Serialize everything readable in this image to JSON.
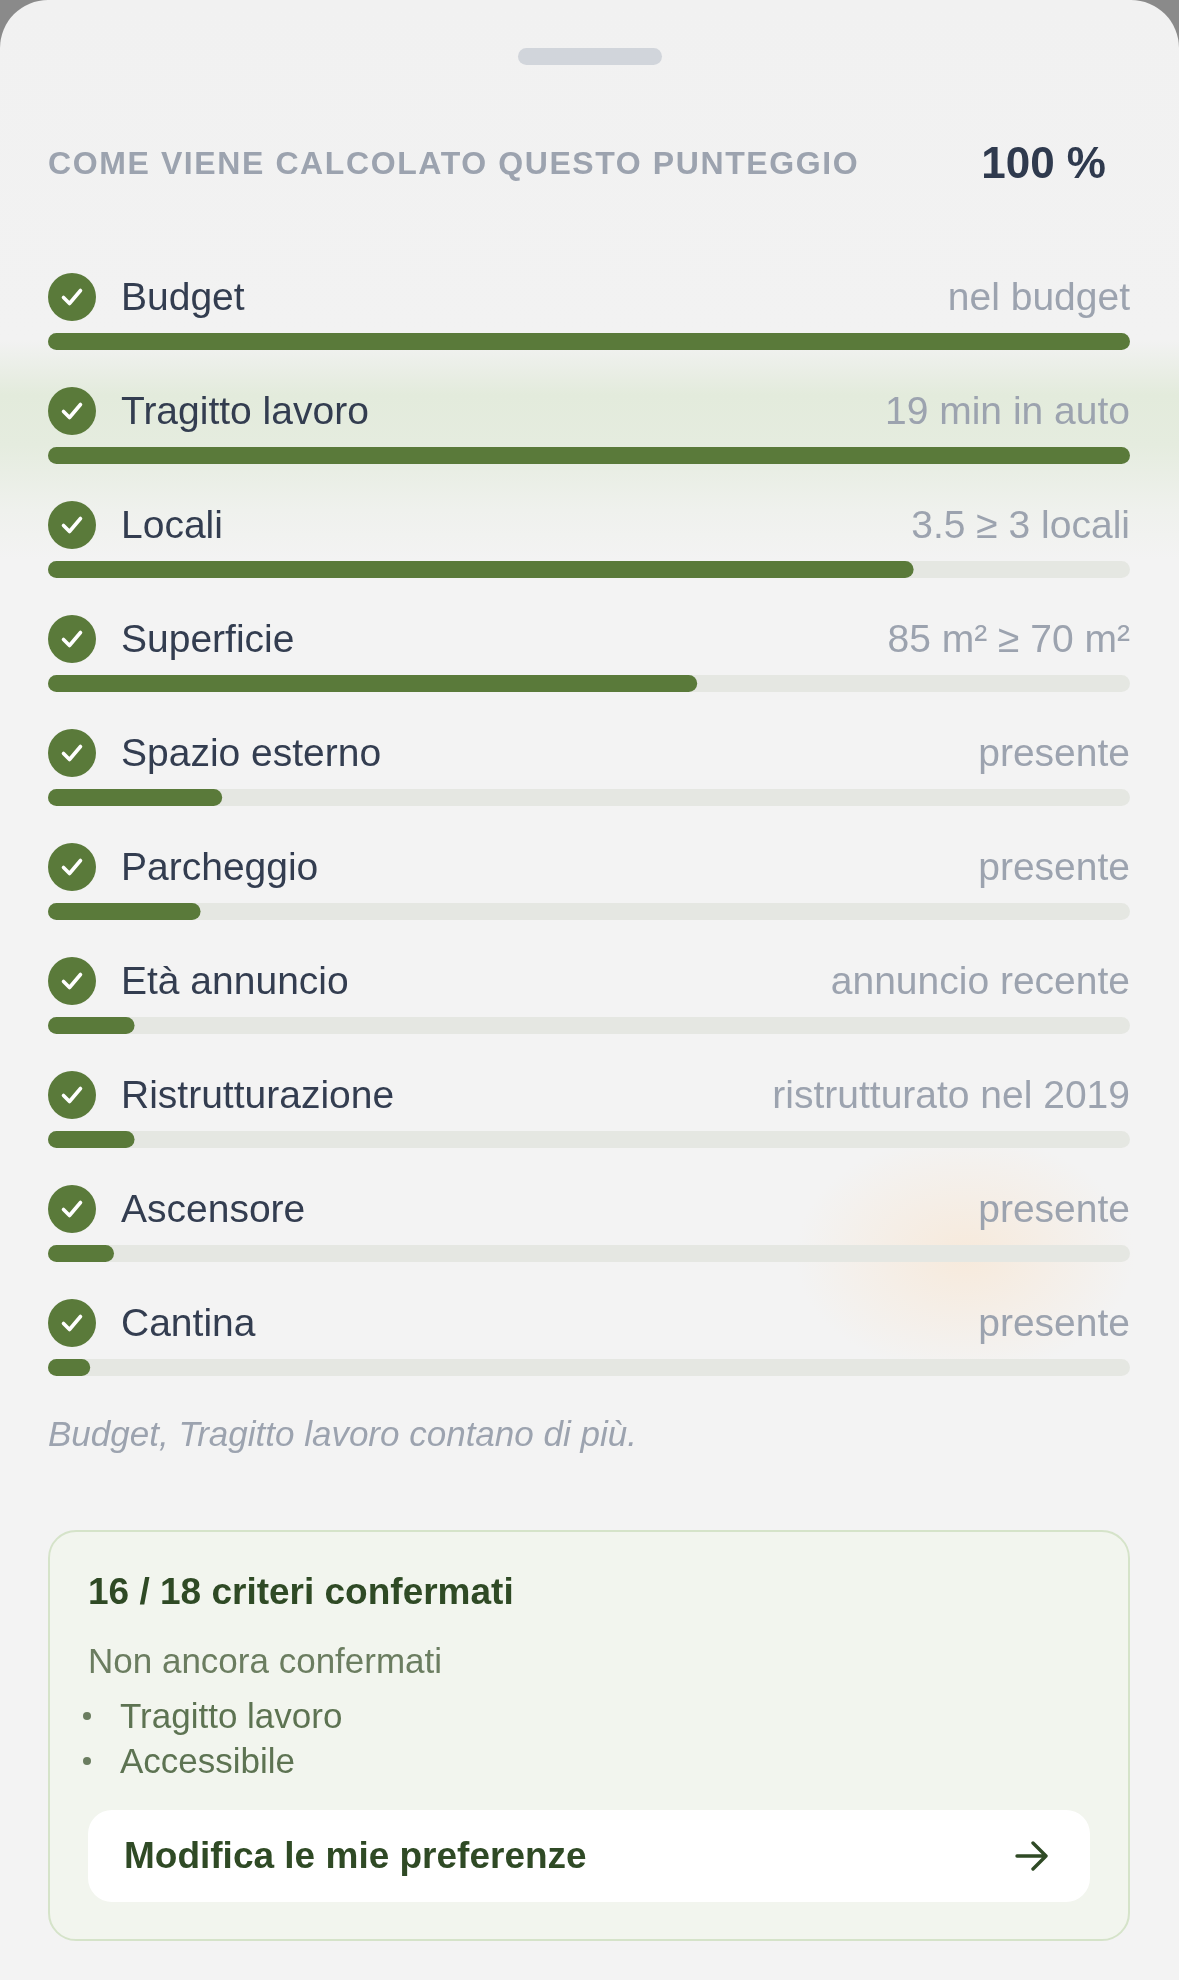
{
  "header": {
    "title": "COME VIENE CALCOLATO QUESTO PUNTEGGIO",
    "score": "100 %"
  },
  "criteria": [
    {
      "label": "Budget",
      "value": "nel budget",
      "checked": true,
      "level": 1.0
    },
    {
      "label": "Tragitto lavoro",
      "value": "19 min in auto",
      "checked": true,
      "level": 1.0
    },
    {
      "label": "Locali",
      "value": "3.5 ≥ 3 locali",
      "checked": true,
      "level": 0.8
    },
    {
      "label": "Superficie",
      "value": "85 m² ≥ 70 m²",
      "checked": true,
      "level": 0.6
    },
    {
      "label": "Spazio esterno",
      "value": "presente",
      "checked": true,
      "level": 0.161
    },
    {
      "label": "Parcheggio",
      "value": "presente",
      "checked": true,
      "level": 0.141
    },
    {
      "label": "Età annuncio",
      "value": "annuncio recente",
      "checked": true,
      "level": 0.08
    },
    {
      "label": "Ristrutturazione",
      "value": "ristrutturato nel 2019",
      "checked": true,
      "level": 0.08
    },
    {
      "label": "Ascensore",
      "value": "presente",
      "checked": true,
      "level": 0.061
    },
    {
      "label": "Cantina",
      "value": "presente",
      "checked": true,
      "level": 0.039
    }
  ],
  "note": "Budget, Tragitto lavoro contano di più.",
  "confirmation_card": {
    "title": "16 / 18 criteri confermati",
    "subtitle": "Non ancora confermati",
    "items": [
      "Tragitto lavoro",
      "Accessibile"
    ],
    "button": "Modifica le mie preferenze"
  }
}
